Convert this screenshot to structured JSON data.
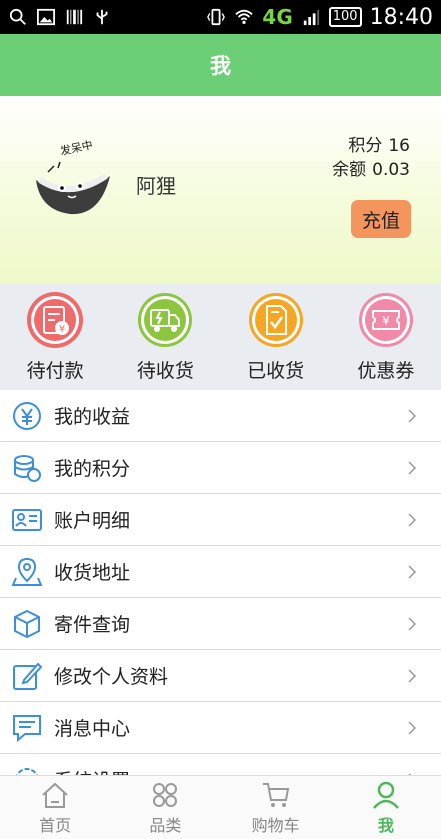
{
  "status_bar": {
    "network": "4G",
    "battery": "100",
    "time": "18:40"
  },
  "header": {
    "title": "我"
  },
  "profile": {
    "avatar_caption": "发呆中",
    "username": "阿狸",
    "points_label": "积分",
    "points_value": "16",
    "balance_label": "余额",
    "balance_value": "0.03",
    "recharge_label": "充值"
  },
  "orders": [
    {
      "label": "待付款",
      "icon": "wallet-icon",
      "color": "#ef6b6b"
    },
    {
      "label": "待收货",
      "icon": "truck-icon",
      "color": "#8cc63f"
    },
    {
      "label": "已收货",
      "icon": "received-doc-icon",
      "color": "#f5a623"
    },
    {
      "label": "优惠券",
      "icon": "coupon-icon",
      "color": "#f08aa8"
    }
  ],
  "menu": [
    {
      "label": "我的收益",
      "icon": "yuan-icon"
    },
    {
      "label": "我的积分",
      "icon": "coins-icon"
    },
    {
      "label": "账户明细",
      "icon": "id-card-icon"
    },
    {
      "label": "收货地址",
      "icon": "location-icon"
    },
    {
      "label": "寄件查询",
      "icon": "package-icon"
    },
    {
      "label": "修改个人资料",
      "icon": "edit-icon"
    },
    {
      "label": "消息中心",
      "icon": "message-icon"
    },
    {
      "label": "系统设置",
      "icon": "settings-icon"
    }
  ],
  "tabs": [
    {
      "label": "首页",
      "icon": "home-icon",
      "active": false
    },
    {
      "label": "品类",
      "icon": "category-icon",
      "active": false
    },
    {
      "label": "购物车",
      "icon": "cart-icon",
      "active": false
    },
    {
      "label": "我",
      "icon": "user-icon",
      "active": true
    }
  ],
  "colors": {
    "title_bar": "#6ccf75",
    "accent_blue": "#3d8fd8",
    "recharge": "#f5955e",
    "active_tab": "#4cb85a"
  }
}
